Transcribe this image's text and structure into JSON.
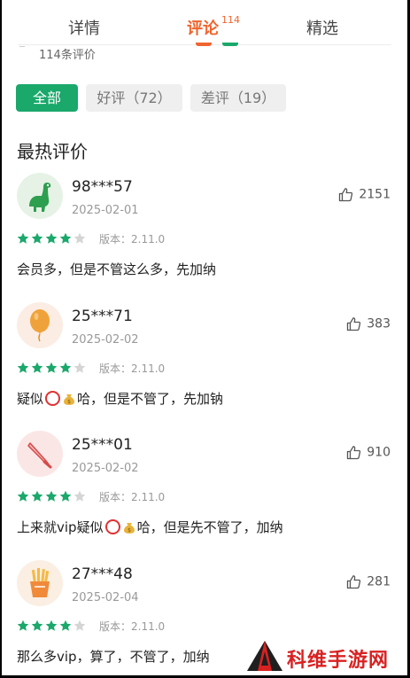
{
  "tabs": [
    {
      "label": "详情"
    },
    {
      "label": "评论",
      "count": "114"
    },
    {
      "label": "精选"
    }
  ],
  "total_count": "114条评价",
  "filters": [
    {
      "label": "全部"
    },
    {
      "label": "好评（72）"
    },
    {
      "label": "差评（19）"
    }
  ],
  "section_title": "最热评价",
  "colors": {
    "accent_green": "#1aa86b",
    "accent_orange": "#f0642d",
    "star_gray": "#d5d5d5"
  },
  "reviews": [
    {
      "user": "98***57",
      "date": "2025-02-01",
      "likes": "2151",
      "rating": 4,
      "version": "版本：2.11.0",
      "content": "会员多，但是不管这么多，先加纳",
      "avatar_icon": "dinosaur-icon"
    },
    {
      "user": "25***71",
      "date": "2025-02-02",
      "likes": "383",
      "rating": 4,
      "version": "版本：2.11.0",
      "content_a": "疑似",
      "content_b": "哈，但是不管了，先加钠",
      "avatar_icon": "balloon-icon"
    },
    {
      "user": "25***01",
      "date": "2025-02-02",
      "likes": "910",
      "rating": 4,
      "version": "版本：2.11.0",
      "content_a": "上来就vip疑似",
      "content_b": "哈，但是先不管了，加纳",
      "avatar_icon": "knife-icon"
    },
    {
      "user": "27***48",
      "date": "2025-02-04",
      "likes": "281",
      "rating": 4,
      "version": "版本：2.11.0",
      "content": "那么多vip，算了，不管了，加纳",
      "avatar_icon": "fries-icon"
    }
  ],
  "watermark": {
    "text": "科维手游网"
  }
}
